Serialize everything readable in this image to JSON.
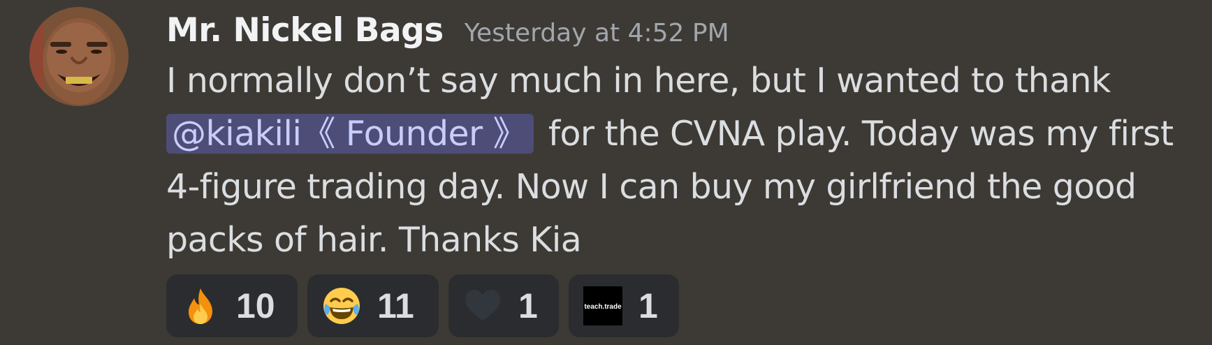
{
  "message": {
    "author": "Mr. Nickel Bags",
    "timestamp": "Yesterday at 4:52 PM",
    "text_before_mention": "I normally don’t say much in here, but I wanted to thank ",
    "mention": "@kiakili《 Founder 》",
    "text_after_mention": " for the CVNA play. Today was my first 4-figure trading day. Now I can buy my girlfriend the good packs of hair. Thanks Kia",
    "mention_color": "#c9cdfb"
  },
  "reactions": [
    {
      "icon": "fire-emoji",
      "count": "10"
    },
    {
      "icon": "tears-of-joy-emoji",
      "count": "11"
    },
    {
      "icon": "black-heart-emoji",
      "count": "1"
    },
    {
      "icon": "teach-trade-custom-emoji",
      "count": "1",
      "label": "teach.trade"
    }
  ]
}
